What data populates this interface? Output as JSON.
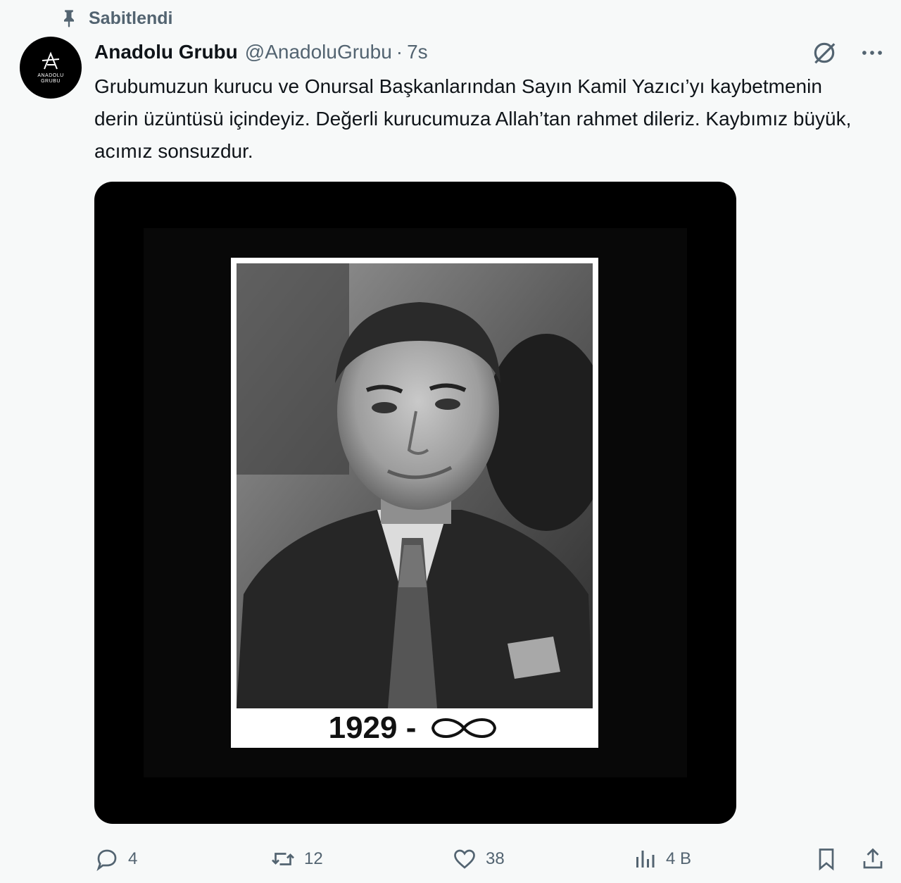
{
  "pinned": {
    "label": "Sabitlendi",
    "icon": "pin-icon"
  },
  "author": {
    "avatar_text": "ANADOLU\nGRUBU",
    "display_name": "Anadolu Grubu",
    "handle": "@AnadoluGrubu",
    "separator": "·",
    "time": "7s"
  },
  "top_icons": [
    "grok-icon",
    "more-icon"
  ],
  "tweet": {
    "text": "Grubumuzun kurucu ve Onursal Başkanlarından Sayın Kamil Yazıcı’yı kaybetmenin derin üzüntüsü içindeyiz. Değerli kurucumuza Allah’tan rahmet dileriz. Kaybımız büyük, acımız sonsuzdur."
  },
  "media": {
    "year_text": "1929 -",
    "infinity_icon": "infinity-icon"
  },
  "actions": {
    "reply_count": "4",
    "retweet_count": "12",
    "like_count": "38",
    "views_count": "4 B"
  },
  "colors": {
    "background": "#f7f9f9",
    "text": "#0f1419",
    "secondary": "#536471"
  }
}
